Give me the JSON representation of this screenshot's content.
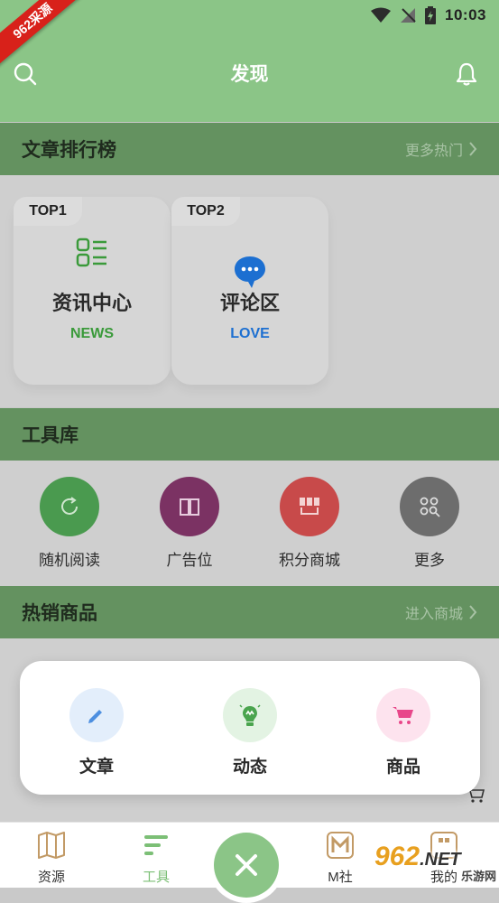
{
  "status_bar": {
    "time": "10:03"
  },
  "ribbon": {
    "text": "962采源"
  },
  "header": {
    "title": "发现"
  },
  "ranking": {
    "title": "文章排行榜",
    "more": "更多热门",
    "cards": [
      {
        "tag": "TOP1",
        "title": "资讯中心",
        "subtitle": "NEWS",
        "color": "#3a9a3a",
        "icon": "list-icon"
      },
      {
        "tag": "TOP2",
        "title": "评论区",
        "subtitle": "LOVE",
        "color": "#1c6fd1",
        "icon": "chat-bubble-icon"
      }
    ]
  },
  "tools": {
    "title": "工具库",
    "items": [
      {
        "label": "随机阅读",
        "color": "#4a9a4f",
        "icon": "refresh-icon"
      },
      {
        "label": "广告位",
        "color": "#7b3263",
        "icon": "book-icon"
      },
      {
        "label": "积分商城",
        "color": "#c84a4a",
        "icon": "store-icon"
      },
      {
        "label": "更多",
        "color": "#6d6d6d",
        "icon": "grid-search-icon"
      }
    ]
  },
  "goods": {
    "title": "热销商品",
    "more": "进入商城"
  },
  "popup": {
    "items": [
      {
        "label": "文章",
        "bg": "#e3eefb",
        "color": "#4d8fe0",
        "icon": "pencil-icon"
      },
      {
        "label": "动态",
        "bg": "#e3f3e3",
        "color": "#4aa44e",
        "icon": "lightbulb-icon"
      },
      {
        "label": "商品",
        "bg": "#fde3ee",
        "color": "#e8478a",
        "icon": "cart-icon"
      }
    ]
  },
  "bottom_nav": {
    "items": [
      {
        "label": "资源",
        "icon": "map-icon"
      },
      {
        "label": "工具",
        "icon": "tools-bars-icon",
        "active": true
      },
      {
        "label": "M社",
        "icon": "m-community-icon"
      },
      {
        "label": "我的",
        "icon": "profile-icon"
      }
    ],
    "active_color": "#7cbf76"
  },
  "watermark": {
    "text": "962",
    "sub": "乐游网",
    "suffix": ".NET"
  }
}
